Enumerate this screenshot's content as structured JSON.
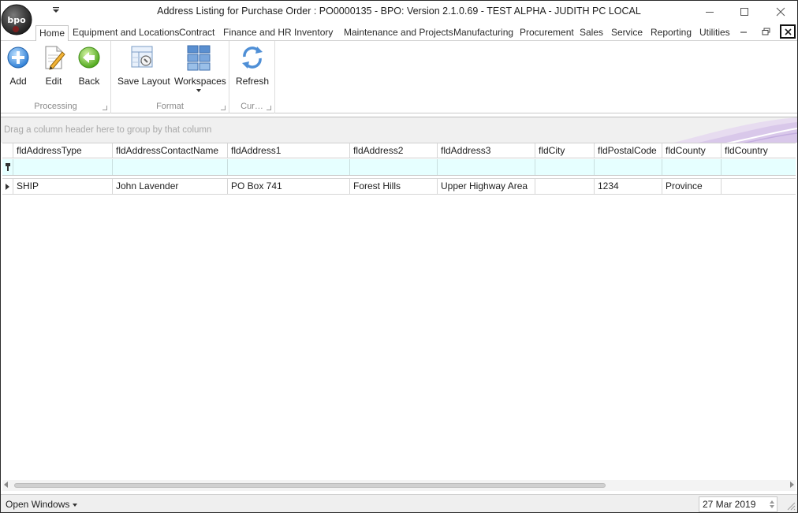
{
  "window": {
    "title": "Address Listing for Purchase Order : PO0000135 - BPO: Version 2.1.0.69 - TEST ALPHA - JUDITH PC LOCAL",
    "logo_icon": "bpo-logo-icon"
  },
  "tabs": [
    {
      "label": "Home",
      "active": true
    },
    {
      "label": "Equipment and Locations"
    },
    {
      "label": "Contract"
    },
    {
      "label": "Finance and HR"
    },
    {
      "label": "Inventory"
    },
    {
      "label": "Maintenance and Projects"
    },
    {
      "label": "Manufacturing"
    },
    {
      "label": "Procurement"
    },
    {
      "label": "Sales"
    },
    {
      "label": "Service"
    },
    {
      "label": "Reporting"
    },
    {
      "label": "Utilities"
    }
  ],
  "ribbon": {
    "groups": [
      {
        "label": "Processing",
        "buttons": [
          {
            "label": "Add",
            "icon": "add-icon"
          },
          {
            "label": "Edit",
            "icon": "edit-icon"
          },
          {
            "label": "Back",
            "icon": "back-icon"
          }
        ]
      },
      {
        "label": "Format",
        "buttons": [
          {
            "label": "Save Layout",
            "icon": "save-layout-icon"
          },
          {
            "label": "Workspaces",
            "icon": "workspaces-icon"
          }
        ]
      },
      {
        "label": "Cur…",
        "buttons": [
          {
            "label": "Refresh",
            "icon": "refresh-icon"
          }
        ]
      }
    ]
  },
  "group_panel": {
    "hint": "Drag a column header here to group by that column"
  },
  "grid": {
    "columns": [
      "fldAddressType",
      "fldAddressContactName",
      "fldAddress1",
      "fldAddress2",
      "fldAddress3",
      "fldCity",
      "fldPostalCode",
      "fldCounty",
      "fldCountry"
    ],
    "rows": [
      [
        "SHIP",
        "John Lavender",
        "PO Box 741",
        "Forest Hills",
        "Upper Highway Area",
        "",
        "1234",
        "Province",
        ""
      ]
    ]
  },
  "statusbar": {
    "open_windows_label": "Open Windows",
    "date": "27 Mar 2019"
  }
}
